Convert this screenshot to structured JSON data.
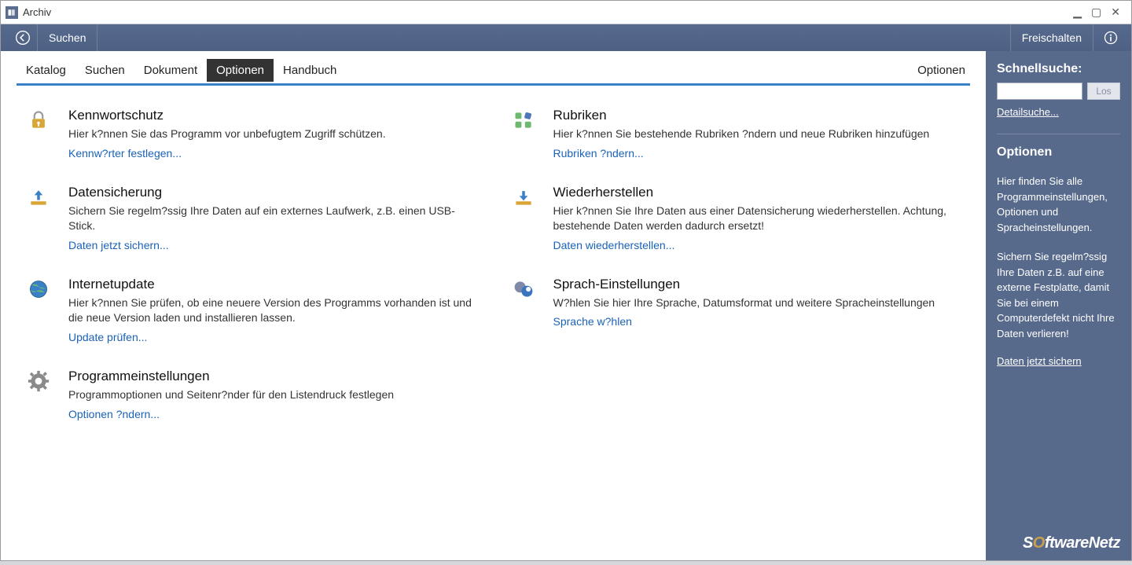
{
  "window": {
    "title": "Archiv"
  },
  "toolbar": {
    "suchen": "Suchen",
    "freischalten": "Freischalten"
  },
  "tabs": {
    "katalog": "Katalog",
    "suchen": "Suchen",
    "dokument": "Dokument",
    "optionen": "Optionen",
    "handbuch": "Handbuch",
    "right": "Optionen"
  },
  "options": {
    "kennwort": {
      "title": "Kennwortschutz",
      "desc": "Hier k?nnen Sie das Programm vor unbefugtem Zugriff schützen.",
      "link": "Kennw?rter festlegen..."
    },
    "rubriken": {
      "title": "Rubriken",
      "desc": "Hier k?nnen Sie bestehende Rubriken ?ndern und neue Rubriken hinzufügen",
      "link": "Rubriken ?ndern..."
    },
    "datensicherung": {
      "title": "Datensicherung",
      "desc": "Sichern Sie regelm?ssig Ihre Daten auf ein externes Laufwerk, z.B. einen USB-Stick.",
      "link": "Daten jetzt sichern..."
    },
    "wiederherstellen": {
      "title": "Wiederherstellen",
      "desc": "Hier k?nnen Sie Ihre Daten aus einer Datensicherung wiederherstellen. Achtung, bestehende Daten werden dadurch ersetzt!",
      "link": "Daten wiederherstellen..."
    },
    "internetupdate": {
      "title": "Internetupdate",
      "desc": "Hier k?nnen Sie prüfen, ob eine neuere Version des Programms vorhanden ist und die neue Version laden und installieren lassen.",
      "link": "Update prüfen..."
    },
    "sprach": {
      "title": "Sprach-Einstellungen",
      "desc": "W?hlen Sie hier Ihre Sprache, Datumsformat und weitere Spracheinstellungen",
      "link": "Sprache w?hlen"
    },
    "programm": {
      "title": "Programmeinstellungen",
      "desc": "Programmoptionen und Seitenr?nder für den Listendruck festlegen",
      "link": "Optionen ?ndern..."
    }
  },
  "sidebar": {
    "schnellsuche": "Schnellsuche:",
    "los": "Los",
    "detail": "Detailsuche...",
    "optionen_title": "Optionen",
    "p1": "Hier finden Sie alle Programmeinstellungen, Optionen und Spracheinstellungen.",
    "p2": "Sichern Sie regelm?ssig Ihre Daten z.B. auf eine externe Festplatte, damit Sie bei einem Computerdefekt nicht Ihre Daten verlieren!",
    "backup_link": "Daten jetzt sichern",
    "brand_pre": "S",
    "brand_o": "O",
    "brand_post": "ftwareNetz"
  }
}
